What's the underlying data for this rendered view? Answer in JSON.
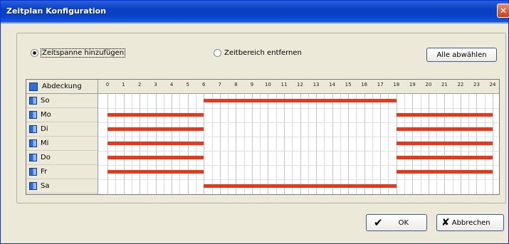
{
  "window": {
    "title": "Zeitplan Konfiguration",
    "close_glyph": "✕"
  },
  "options": {
    "add_label": "Zeitspanne hinzufügen",
    "remove_label": "Zeitbereich entfernen",
    "selected": "add",
    "deselect_all_label": "Alle abwählen"
  },
  "grid": {
    "header_label": "Abdeckung",
    "hours": [
      "0",
      "1",
      "2",
      "3",
      "4",
      "5",
      "6",
      "7",
      "8",
      "9",
      "10",
      "11",
      "12",
      "13",
      "14",
      "15",
      "16",
      "17",
      "18",
      "19",
      "20",
      "21",
      "22",
      "23",
      "24"
    ],
    "days": [
      {
        "label": "So",
        "spans": [
          [
            6,
            18
          ]
        ]
      },
      {
        "label": "Mo",
        "spans": [
          [
            0,
            6
          ],
          [
            18,
            24
          ]
        ]
      },
      {
        "label": "Di",
        "spans": [
          [
            0,
            6
          ],
          [
            18,
            24
          ]
        ]
      },
      {
        "label": "Mi",
        "spans": [
          [
            0,
            6
          ],
          [
            18,
            24
          ]
        ]
      },
      {
        "label": "Do",
        "spans": [
          [
            0,
            6
          ],
          [
            18,
            24
          ]
        ]
      },
      {
        "label": "Fr",
        "spans": [
          [
            0,
            6
          ],
          [
            18,
            24
          ]
        ]
      },
      {
        "label": "Sa",
        "spans": [
          [
            6,
            18
          ]
        ]
      }
    ],
    "bar_color": "#e8371a"
  },
  "footer": {
    "ok_label": "OK",
    "cancel_label": "Abbrechen"
  }
}
